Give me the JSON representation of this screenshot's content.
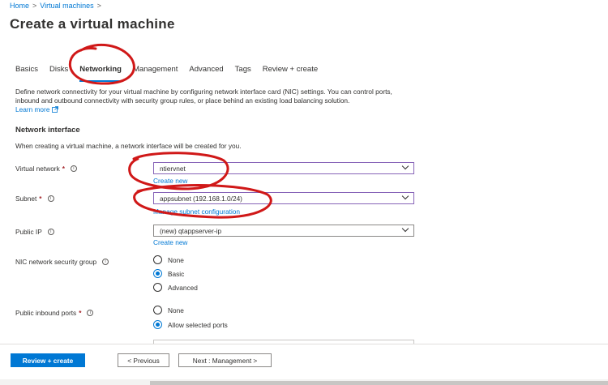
{
  "breadcrumb": {
    "home": "Home",
    "virtual_machines": "Virtual machines",
    "sep1": ">",
    "sep2": ">"
  },
  "page_title": "Create a virtual machine",
  "tabs": [
    {
      "label": "Basics",
      "active": false
    },
    {
      "label": "Disks",
      "active": false
    },
    {
      "label": "Networking",
      "active": true
    },
    {
      "label": "Management",
      "active": false
    },
    {
      "label": "Advanced",
      "active": false
    },
    {
      "label": "Tags",
      "active": false
    },
    {
      "label": "Review + create",
      "active": false
    }
  ],
  "description": "Define network connectivity for your virtual machine by configuring network interface card (NIC) settings. You can control ports, inbound and outbound connectivity with security group rules, or place behind an existing load balancing solution.",
  "learn_more": "Learn more",
  "network_interface": {
    "title": "Network interface",
    "desc": "When creating a virtual machine, a network interface will be created for you."
  },
  "fields": {
    "virtual_network": {
      "label": "Virtual network",
      "required": "*",
      "value": "ntiervnet",
      "link": "Create new"
    },
    "subnet": {
      "label": "Subnet",
      "required": "*",
      "value": "appsubnet (192.168.1.0/24)",
      "link": "Manage subnet configuration"
    },
    "public_ip": {
      "label": "Public IP",
      "value": "(new) qtappserver-ip",
      "link": "Create new"
    },
    "nic_nsg": {
      "label": "NIC network security group",
      "options": [
        "None",
        "Basic",
        "Advanced"
      ],
      "selected": "Basic"
    },
    "public_inbound_ports": {
      "label": "Public inbound ports",
      "required": "*",
      "options": [
        "None",
        "Allow selected ports"
      ],
      "selected": "Allow selected ports"
    }
  },
  "info_glyph": "i",
  "footer": {
    "review_create": "Review + create",
    "previous": "< Previous",
    "next": "Next : Management >"
  },
  "colors": {
    "accent": "#0078d4",
    "annotation": "#d01818",
    "required": "#a4262c",
    "select_border_active": "#8764b8"
  }
}
